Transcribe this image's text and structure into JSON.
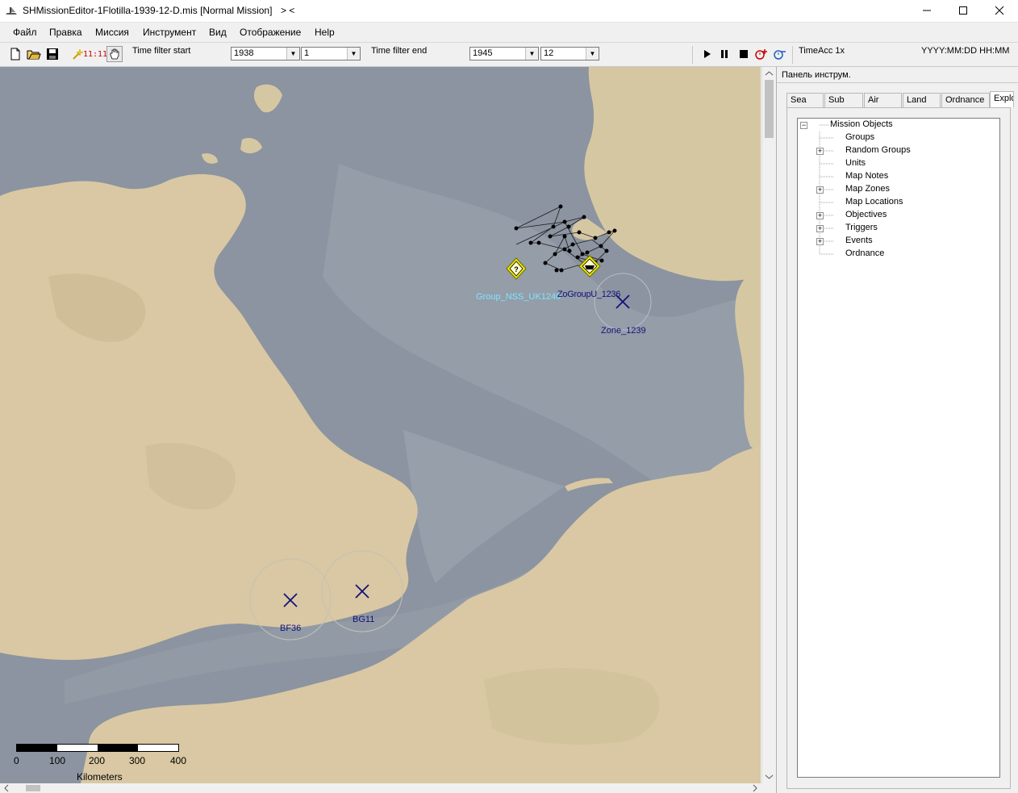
{
  "window": {
    "title": "SHMissionEditor-1Flotilla-1939-12-D.mis [Normal Mission]",
    "nav_arrows": "> <",
    "minimize": "—",
    "maximize": "☐",
    "close": "✕"
  },
  "menu": [
    "Файл",
    "Правка",
    "Миссия",
    "Инструмент",
    "Вид",
    "Отображение",
    "Help"
  ],
  "toolbar": {
    "clock_label": "11:11",
    "time_filter_start_label": "Time filter start",
    "start_year": "1938",
    "start_month": "1",
    "time_filter_end_label": "Time filter end",
    "end_year": "1945",
    "end_month": "12",
    "time_acc": "TimeAcc 1x",
    "datetime_format": "YYYY:MM:DD HH:MM"
  },
  "panel": {
    "title": "Панель инструм.",
    "tabs": [
      "Sea",
      "Sub",
      "Air",
      "Land",
      "Ordnance",
      "Explo"
    ],
    "active_tab": "Explo",
    "tree": {
      "root": "Mission Objects",
      "children": [
        {
          "label": "Groups",
          "expandable": false
        },
        {
          "label": "Random Groups",
          "expandable": true
        },
        {
          "label": "Units",
          "expandable": false
        },
        {
          "label": "Map Notes",
          "expandable": false
        },
        {
          "label": "Map Zones",
          "expandable": true
        },
        {
          "label": "Map Locations",
          "expandable": false
        },
        {
          "label": "Objectives",
          "expandable": true
        },
        {
          "label": "Triggers",
          "expandable": true
        },
        {
          "label": "Events",
          "expandable": true
        },
        {
          "label": "Ordnance",
          "expandable": false
        }
      ]
    }
  },
  "map": {
    "labels": {
      "group_nss": "Group_NSS_UK1240",
      "group_overlap": "ZoGroupU_1236",
      "zone_1239": "Zone_1239",
      "bf36": "BF36",
      "bg11": "BG11"
    },
    "scale": {
      "ticks": [
        "0",
        "100",
        "200",
        "300",
        "400"
      ],
      "unit": "Kilometers"
    },
    "colors": {
      "sea": "#8b94a0",
      "land": "#d9c8a3",
      "marker_label": "#7fe5ff",
      "zone_mark": "#12127a",
      "waypoint_marker": "#f2ea00"
    }
  }
}
